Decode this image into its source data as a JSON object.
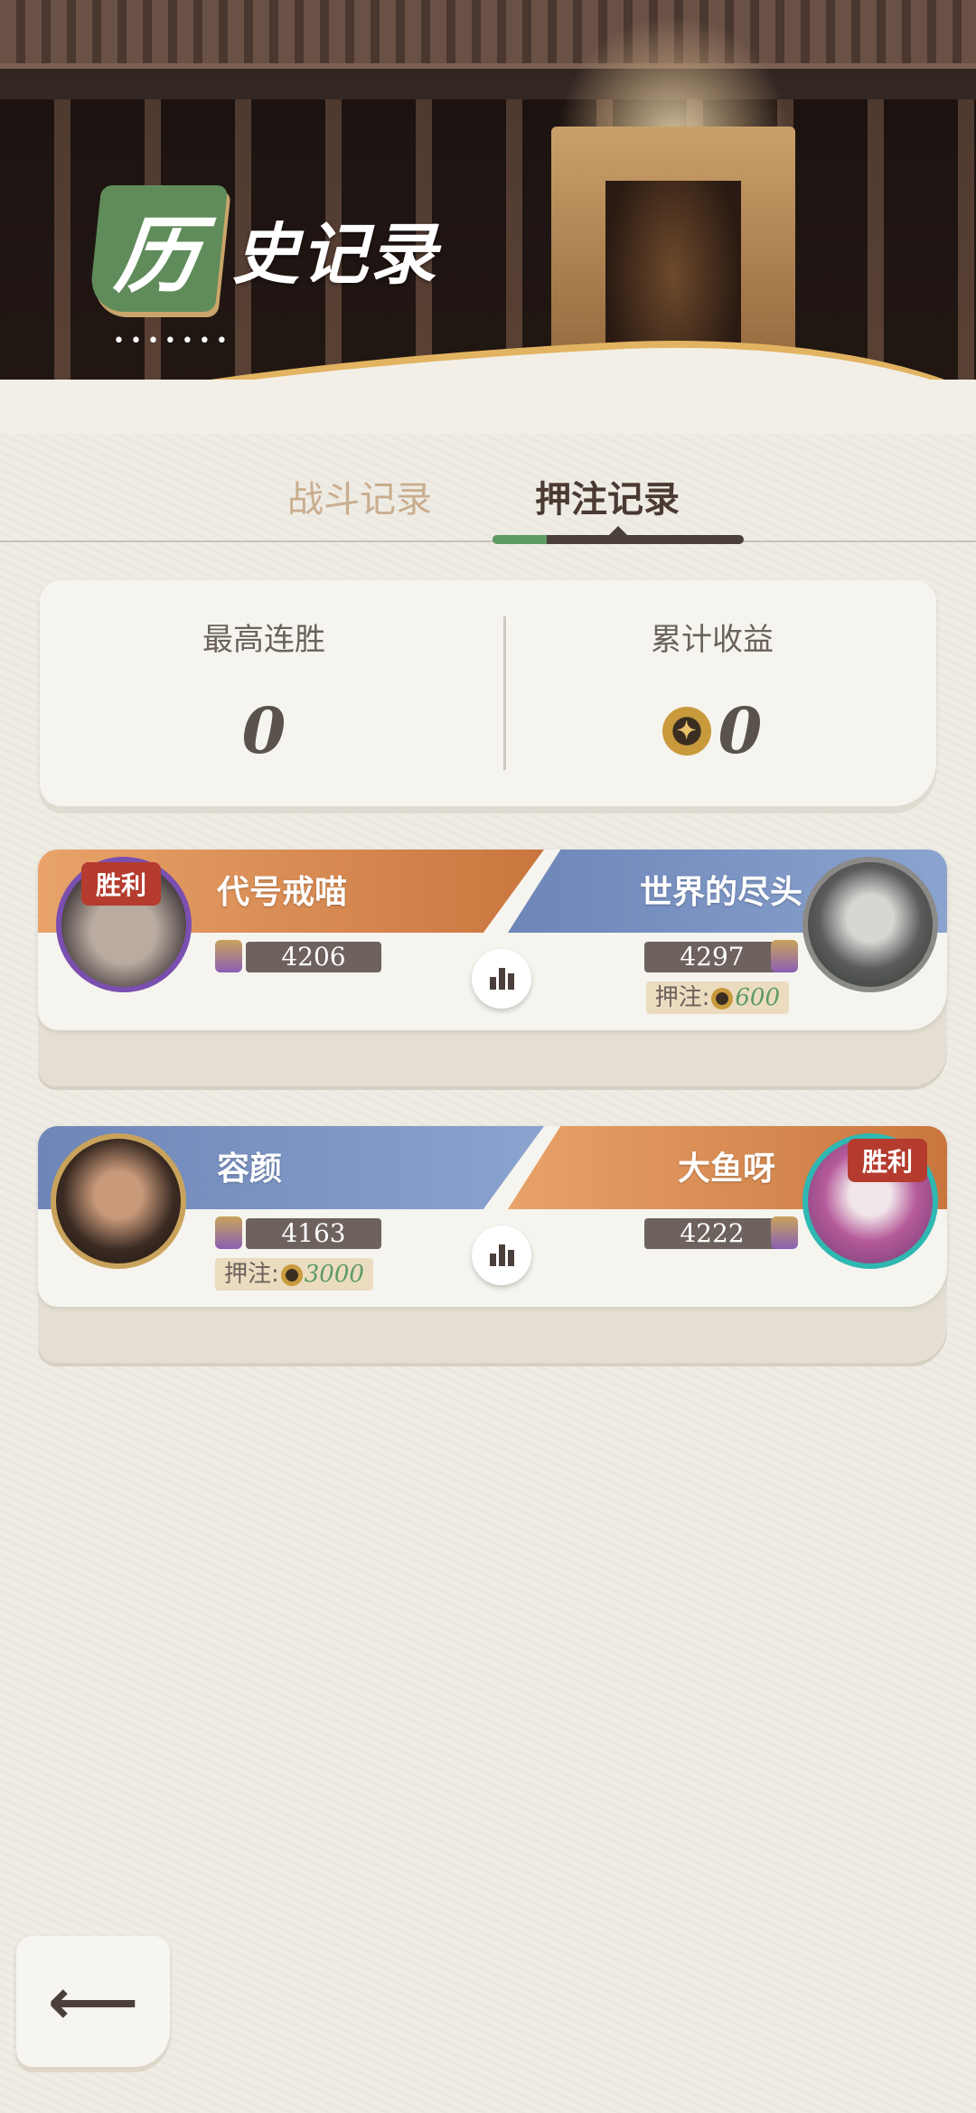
{
  "header": {
    "title_first_char": "历",
    "title_rest": "史记录",
    "dots": "•••••••"
  },
  "tabs": [
    {
      "label": "战斗记录",
      "active": false
    },
    {
      "label": "押注记录",
      "active": true
    }
  ],
  "stats": {
    "max_streak_label": "最高连胜",
    "max_streak_value": "0",
    "total_income_label": "累计收益",
    "total_income_value": "0"
  },
  "matches": [
    {
      "left": {
        "name": "代号戒喵",
        "score": "4206",
        "win_label": "胜利",
        "bet": null
      },
      "right": {
        "name": "世界的尽头",
        "score": "4297",
        "win_label": null,
        "bet_label": "押注:",
        "bet_amount": "600"
      }
    },
    {
      "left": {
        "name": "容颜",
        "score": "4163",
        "win_label": null,
        "bet_label": "押注:",
        "bet_amount": "3000"
      },
      "right": {
        "name": "大鱼呀",
        "score": "4222",
        "win_label": "胜利",
        "bet": null
      }
    }
  ],
  "icons": {
    "back": "back-arrow-icon",
    "stats": "bar-chart-icon",
    "coin": "coin-icon"
  },
  "colors": {
    "accent_green": "#5d9a64",
    "win_red": "#b43b2e",
    "orange_band": "#c9763e",
    "blue_band": "#6e86b8"
  }
}
